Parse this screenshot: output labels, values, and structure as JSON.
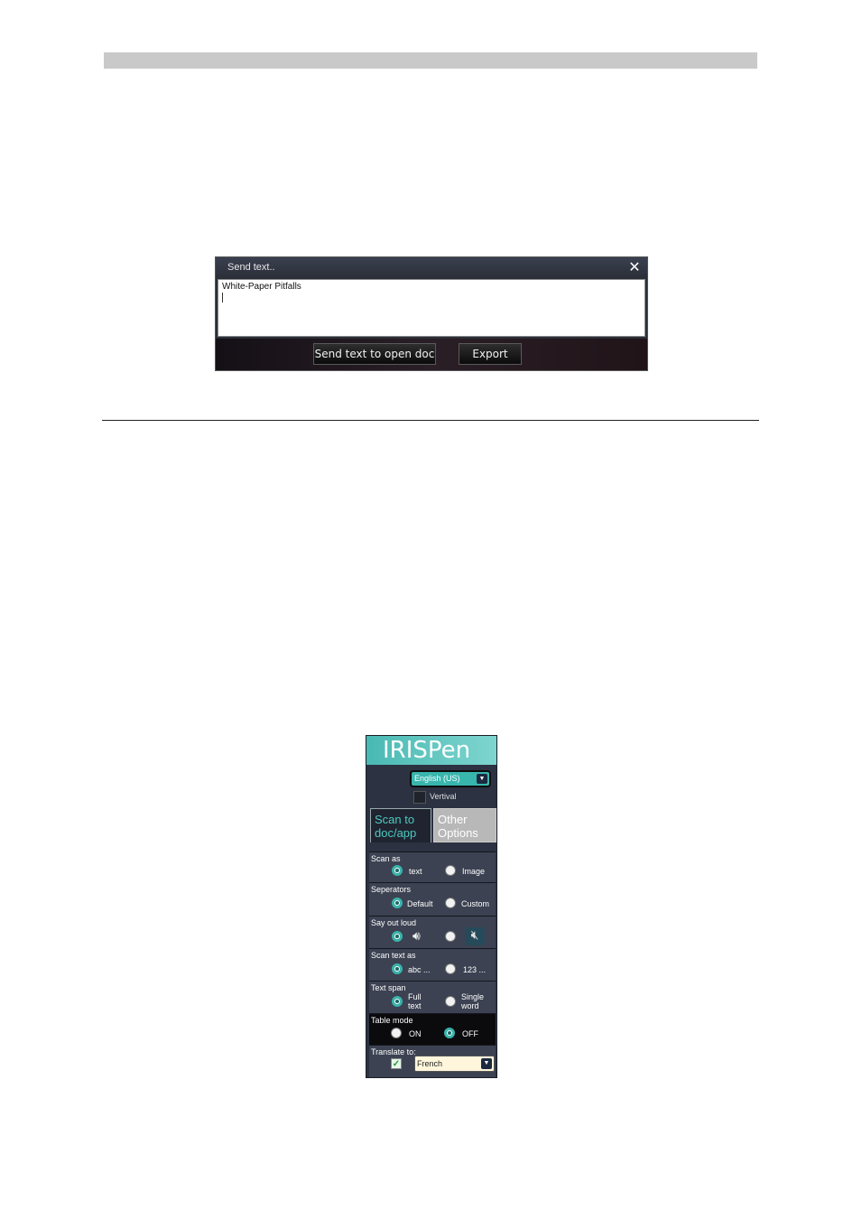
{
  "send_window": {
    "title": "Send text..",
    "close_glyph": "✕",
    "text_content": "White-Paper Pitfalls",
    "send_button": "Send text to open doc",
    "export_button": "Export"
  },
  "irispen": {
    "logo": "IRISPen",
    "language": "English (US)",
    "vertical_label": "Vertival",
    "tabs": [
      "Scan to doc/app",
      "Other Options"
    ],
    "sections": {
      "scan_as": {
        "label": "Scan as",
        "opt1": "text",
        "opt2": "Image",
        "selected": "text"
      },
      "separators": {
        "label": "Seperators",
        "opt1": "Default",
        "opt2": "Custom",
        "selected": "Default"
      },
      "say_out_loud": {
        "label": "Say out loud",
        "icon1": "speaker-icon",
        "icon2": "speaker-muted-icon",
        "selected": "speaker-icon"
      },
      "scan_text_as": {
        "label": "Scan text as",
        "opt1": "abc ...",
        "opt2": "123 ...",
        "selected": "abc ..."
      },
      "text_span": {
        "label": "Text span",
        "opt1": "Full text",
        "opt2": "Single word",
        "selected": "Full text"
      },
      "table_mode": {
        "label": "Table mode",
        "opt1": "ON",
        "opt2": "OFF",
        "selected": "OFF"
      },
      "translate_to": {
        "label": "Translate to:",
        "language": "French",
        "checked": true
      }
    }
  },
  "colors": {
    "accent": "#3ab3ab",
    "panel_bg": "#2c3241",
    "header_teal": "#49b9b3"
  }
}
